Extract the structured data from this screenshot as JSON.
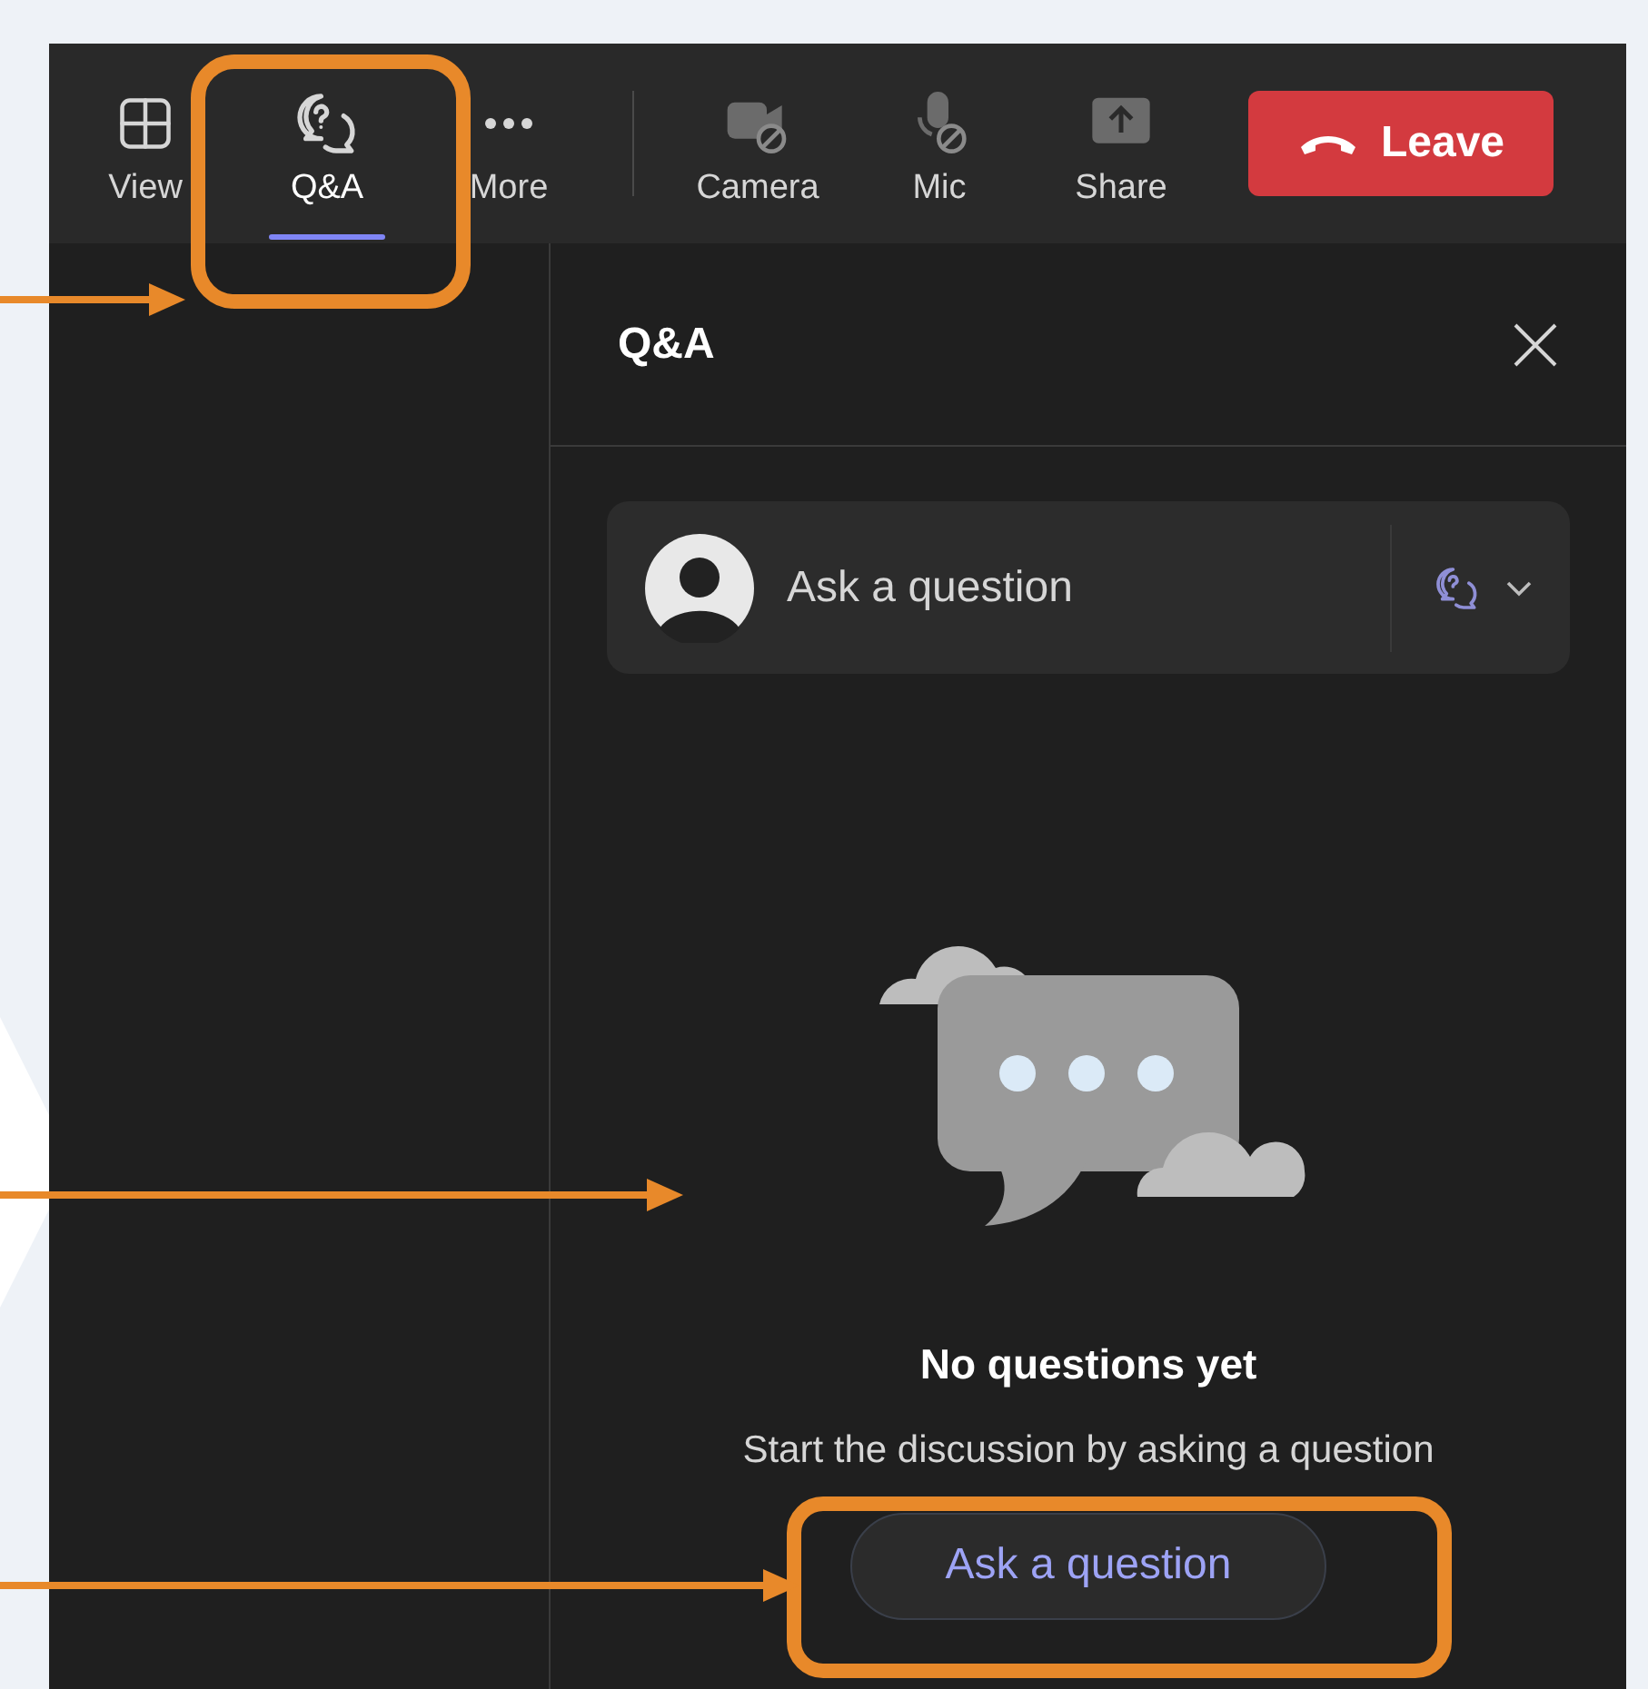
{
  "toolbar": {
    "items": [
      {
        "label": "View",
        "selected": false
      },
      {
        "label": "Q&A",
        "selected": true
      },
      {
        "label": "More",
        "selected": false
      },
      {
        "label": "Camera",
        "selected": false
      },
      {
        "label": "Mic",
        "selected": false
      },
      {
        "label": "Share",
        "selected": false
      }
    ],
    "leave_button": "Leave"
  },
  "panel": {
    "title": "Q&A",
    "compose": {
      "placeholder": "Ask a question"
    },
    "empty_state": {
      "title": "No questions yet",
      "message": "Start the discussion by asking a question",
      "button": "Ask a question"
    }
  }
}
